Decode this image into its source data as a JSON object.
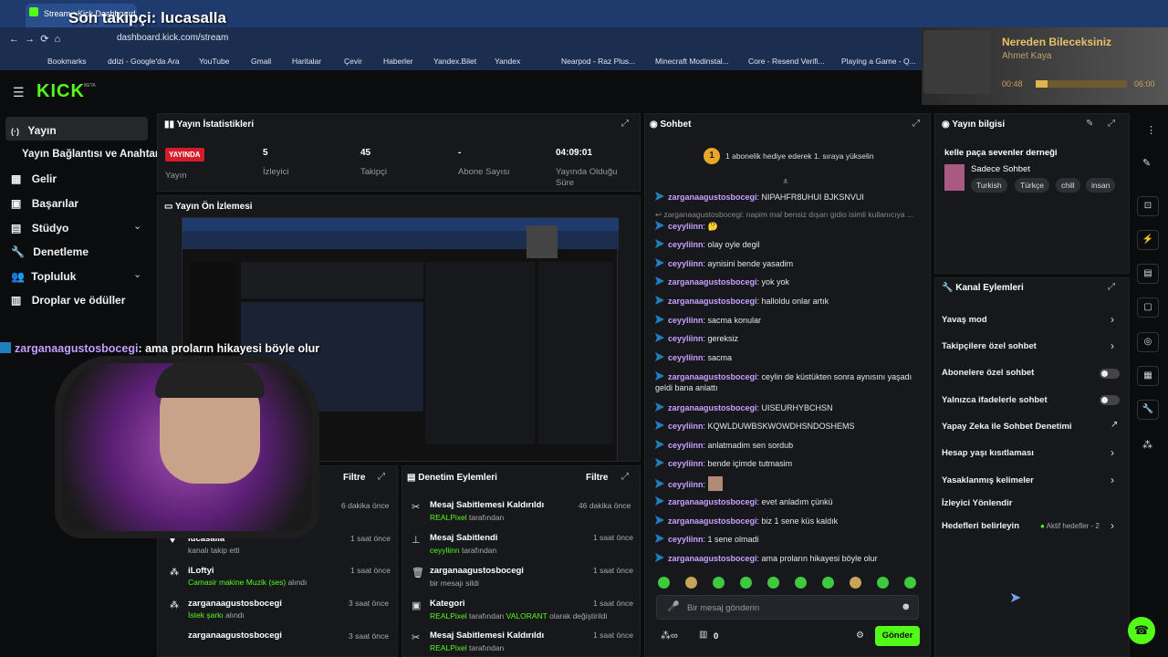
{
  "browser": {
    "tab_title": "Stream - Kick Dashboard",
    "url": "dashboard.kick.com/stream",
    "bookmarks": [
      "Bookmarks",
      "ddizi - Google'da Ara",
      "YouTube",
      "Gmail",
      "Haritalar",
      "Çevir",
      "Haberler",
      "Yandex.Bilet",
      "Yandex",
      "Nearpod - Raz Plus...",
      "Minecraft Modinstal...",
      "Core - Resend Verifi...",
      "Playing a Game - Q..."
    ]
  },
  "overlay": {
    "last_follower": "Son takipçi: lucasalla",
    "chat_popup_user": "zarganaagustosbocegi",
    "chat_popup_msg": ": ama proların hikayesi böyle olur"
  },
  "music": {
    "title": "Nereden Bileceksiniz",
    "artist": "Ahmet Kaya",
    "time_cur": "00:48",
    "time_total": "06:00",
    "progress": 0.13
  },
  "logo": "KICK",
  "logo_badge": "BETA",
  "sidebar": [
    "Yayın",
    "Yayın Bağlantısı ve Anahtarı",
    "Gelir",
    "Başarılar",
    "Stüdyo",
    "Denetleme",
    "Topluluk",
    "Droplar ve ödüller"
  ],
  "stats": {
    "title": "Yayın İstatistikleri",
    "live": "YAYINDA",
    "live_label": "Yayın",
    "viewers": "5",
    "viewers_label": "İzleyici",
    "followers": "45",
    "followers_label": "Takipçi",
    "subs": "-",
    "subs_label": "Abone Sayısı",
    "duration": "04:09:01",
    "duration_label": "Yayında Olduğu Süre"
  },
  "preview": {
    "title": "Yayın Ön İzlemesi"
  },
  "feed_left": {
    "filter": "Filtre",
    "items": [
      {
        "time": "6 dakika önce"
      },
      {
        "user": "lucasalla",
        "desc": "kanalı takip etti",
        "time": "1 saat önce"
      },
      {
        "user": "iLoftyi",
        "desc_a": "Camasir makine Muzik (ses)",
        "desc_b": " alındı",
        "time": "1 saat önce"
      },
      {
        "user": "zarganaagustosbocegi",
        "desc_a": "İstek şarkı",
        "desc_b": " alındı",
        "time": "3 saat önce"
      },
      {
        "user": "zarganaagustosbocegi",
        "time": "3 saat önce"
      }
    ]
  },
  "mod": {
    "title": "Denetim Eylemleri",
    "filter": "Filtre",
    "items": [
      {
        "t": "Mesaj Sabitlemesi Kaldırıldı",
        "u": "REALPixel",
        "s": " tarafından",
        "time": "46 dakika önce"
      },
      {
        "t": "Mesaj Sabitlendi",
        "u": "ceyyliinn",
        "s": " tarafından",
        "time": "1 saat önce"
      },
      {
        "t": "zarganaagustosbocegi",
        "u": "",
        "s": "bir mesajı sildi",
        "time": "1 saat önce"
      },
      {
        "t": "Kategori",
        "u": "REALPixel",
        "s": " tarafından ",
        "u2": "VALORANT",
        "s2": " olarak değiştirildi",
        "time": "1 saat önce"
      },
      {
        "t": "Mesaj Sabitlemesi Kaldırıldı",
        "u": "REALPixel",
        "s": " tarafından",
        "time": "1 saat önce"
      }
    ]
  },
  "chat": {
    "title": "Sohbet",
    "gift_banner": "1 abonelik hediye ederek 1. sıraya yükselin",
    "gift_rank": "1",
    "deleted": "zarganaagustosbocegi: napim mal bensiz dışarı gidio isimli kullanıcıya ...",
    "messages": [
      {
        "u": "zarganaagustosbocegi",
        "m": ": NIPAHFR8UHUI BJKSNVUI"
      },
      {
        "u": "ceyyliinn",
        "m": ": 🤔"
      },
      {
        "u": "ceyyliinn",
        "m": ": olay oyle degil"
      },
      {
        "u": "ceyyliinn",
        "m": ": aynisini bende yasadim"
      },
      {
        "u": "zarganaagustosbocegi",
        "m": ": yok yok"
      },
      {
        "u": "zarganaagustosbocegi",
        "m": ": halloldu onlar artık"
      },
      {
        "u": "ceyyliinn",
        "m": ": sacma konular"
      },
      {
        "u": "ceyyliinn",
        "m": ": gereksiz"
      },
      {
        "u": "ceyyliinn",
        "m": ": sacma"
      },
      {
        "u": "zarganaagustosbocegi",
        "m": ": ceylin de küstükten sonra aynısını yaşadı geldi bana anlattı"
      },
      {
        "u": "zarganaagustosbocegi",
        "m": ": UISEURHYBCHSN"
      },
      {
        "u": "ceyyliinn",
        "m": ": KQWLDUWBSKWOWDHSNDOSHEMS"
      },
      {
        "u": "ceyyliinn",
        "m": ": anlatmadim sen sordub"
      },
      {
        "u": "ceyyliinn",
        "m": ": bende içimde tutmasim"
      },
      {
        "u": "ceyyliinn",
        "m": ": "
      },
      {
        "u": "zarganaagustosbocegi",
        "m": ": evet anladım çünkü"
      },
      {
        "u": "zarganaagustosbocegi",
        "m": ": biz 1 sene küs kaldık"
      },
      {
        "u": "ceyyliinn",
        "m": ": 1 sene olmadi"
      },
      {
        "u": "zarganaagustosbocegi",
        "m": ": ama proların hikayesi böyle olur"
      }
    ],
    "input_placeholder": "Bir mesaj gönderin",
    "points": "0",
    "send": "Gönder"
  },
  "info": {
    "title": "Yayın bilgisi",
    "stream_title": "kelle paça sevenler derneği",
    "category": "Sadece Sohbet",
    "tags": [
      "Turkish",
      "Türkçe",
      "chill",
      "insan"
    ]
  },
  "actions": {
    "title": "Kanal Eylemleri",
    "rows": [
      "Yavaş mod",
      "Takipçilere özel sohbet",
      "Abonelere özel sohbet",
      "Yalnızca ifadelerle sohbet",
      "Yapay Zeka ile Sohbet Denetimi",
      "Hesap yaşı kısıtlaması",
      "Yasaklanmış kelimeler",
      "İzleyici Yönlendir",
      "Hedefleri belirleyin"
    ],
    "goals_active": "Aktif hedefler - 2"
  }
}
